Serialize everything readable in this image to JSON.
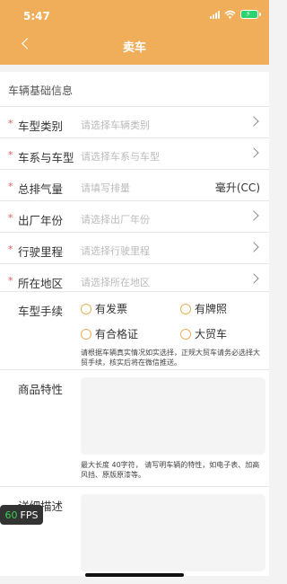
{
  "status": {
    "time": "5:47"
  },
  "header": {
    "title": "卖车"
  },
  "section": {
    "title": "车辆基础信息"
  },
  "rows": [
    {
      "star": "*",
      "label": "车型类别",
      "placeholder": "请选择车辆类别"
    },
    {
      "star": "*",
      "label": "车系与车型",
      "placeholder": "请选择车系与车型"
    },
    {
      "star": "*",
      "label": "总排气量",
      "placeholder": "请填写排量",
      "unit": "毫升(CC)"
    },
    {
      "star": "*",
      "label": "出厂年份",
      "placeholder": "请选择出厂年份"
    },
    {
      "star": "*",
      "label": "行驶里程",
      "placeholder": "请选择行驶里程"
    },
    {
      "star": "*",
      "label": "所在地区",
      "placeholder": "请选择所在地区"
    }
  ],
  "procedures": {
    "label": "车型手续",
    "options": [
      "有发票",
      "有牌照",
      "有合格证",
      "大贸车"
    ],
    "hint": "请根据车辆真实情况如实选择，正规大贸车请务必选择大贸手续，核实后将在微信推送。"
  },
  "features": {
    "label": "商品特性",
    "hint": "最大长度 40字符， 请写明车辆的特性，如电子表、加高风挡、原版原漆等。"
  },
  "detail": {
    "label": "详细描述"
  },
  "fps": {
    "value": "60",
    "unit": "FPS"
  }
}
